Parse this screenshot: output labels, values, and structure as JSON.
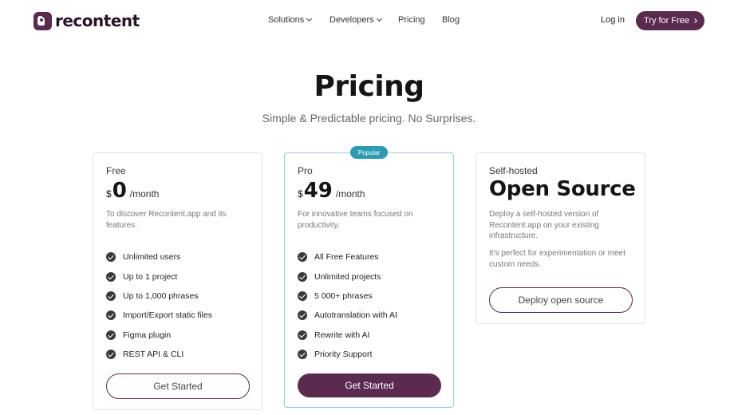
{
  "brand": {
    "name": "recontent",
    "color": "#5a2a4f",
    "accent": "#2b9bb3"
  },
  "nav": {
    "items": [
      {
        "label": "Solutions",
        "has_dropdown": true
      },
      {
        "label": "Developers",
        "has_dropdown": true
      },
      {
        "label": "Pricing",
        "has_dropdown": false
      },
      {
        "label": "Blog",
        "has_dropdown": false
      }
    ],
    "login": "Log in",
    "cta": "Try for Free"
  },
  "hero": {
    "title": "Pricing",
    "subtitle": "Simple & Predictable pricing. No Surprises."
  },
  "plans": {
    "free": {
      "name": "Free",
      "currency": "$",
      "price": "0",
      "period": "/month",
      "description": "To discover Recontent.app and its features.",
      "features": [
        "Unlimited users",
        "Up to 1 project",
        "Up to 1,000 phrases",
        "Import/Export static files",
        "Figma plugin",
        "REST API & CLI"
      ],
      "button": "Get Started"
    },
    "pro": {
      "badge": "Popular",
      "name": "Pro",
      "currency": "$",
      "price": "49",
      "period": "/month",
      "description": "For innovative teams focused on productivity.",
      "features": [
        "All Free Features",
        "Unlimited projects",
        "5 000+ phrases",
        "Autotranslation with AI",
        "Rewrite with AI",
        "Priority Support"
      ],
      "button": "Get Started"
    },
    "self_hosted": {
      "name": "Self-hosted",
      "title": "Open Source",
      "description": "Deploy a self-hosted version of Recontent.app on your existing infrastructure.",
      "description2": "It's perfect for experimentation or meet custom needs.",
      "button": "Deploy open source"
    }
  }
}
